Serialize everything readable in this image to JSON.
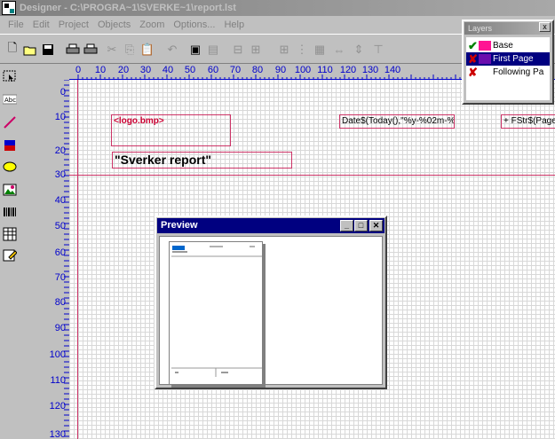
{
  "window": {
    "title": "Designer - C:\\PROGRA~1\\SVERKE~1\\report.lst"
  },
  "menu": [
    "File",
    "Edit",
    "Project",
    "Objects",
    "Zoom",
    "Options...",
    "Help"
  ],
  "toolbar": {
    "buttons": [
      "new-icon",
      "open-icon",
      "save-icon",
      "print-icon",
      "print-preview-icon",
      "cut-icon",
      "copy-icon",
      "paste-icon",
      "undo-icon",
      "to-front-icon",
      "to-back-icon",
      "align-left-icon",
      "align-center-icon",
      "align-grid-icon",
      "distribute-icon",
      "same-size-icon",
      "space-evenly-icon",
      "center-icon"
    ]
  },
  "palette": [
    "select-tool-icon",
    "text-tool-icon",
    "line-tool-icon",
    "rectangle-tool-icon",
    "ellipse-tool-icon",
    "picture-tool-icon",
    "barcode-tool-icon",
    "table-tool-icon",
    "form-tool-icon"
  ],
  "ruler": {
    "horizontal": [
      "0",
      "10",
      "20",
      "30",
      "40",
      "50",
      "60",
      "70",
      "80",
      "90",
      "100",
      "110",
      "120",
      "130",
      "140"
    ],
    "vertical": [
      "0",
      "10",
      "20",
      "30",
      "40",
      "50",
      "60",
      "70",
      "80",
      "90",
      "100",
      "110",
      "120",
      "130"
    ]
  },
  "objects": {
    "logo": "<logo.bmp>",
    "date": "Date$(Today(),\"%y-%02m-%0",
    "page": "+ FStr$(Page",
    "title": "\"Sverker report\""
  },
  "preview": {
    "title": "Preview",
    "minimize_label": "_",
    "maximize_label": "□",
    "close_label": "✕"
  },
  "layers": {
    "title": "Layers",
    "close_label": "x",
    "items": [
      {
        "name": "Base",
        "check": "✔",
        "color": "#ff1493"
      },
      {
        "name": "First Page",
        "check": "✘",
        "color": "#cc0000"
      },
      {
        "name": "Following Pa",
        "check": "✘",
        "color": ""
      }
    ]
  },
  "colors": {
    "ruler_text": "#0000cc",
    "object_border": "#cc3366",
    "selection": "#000080"
  }
}
